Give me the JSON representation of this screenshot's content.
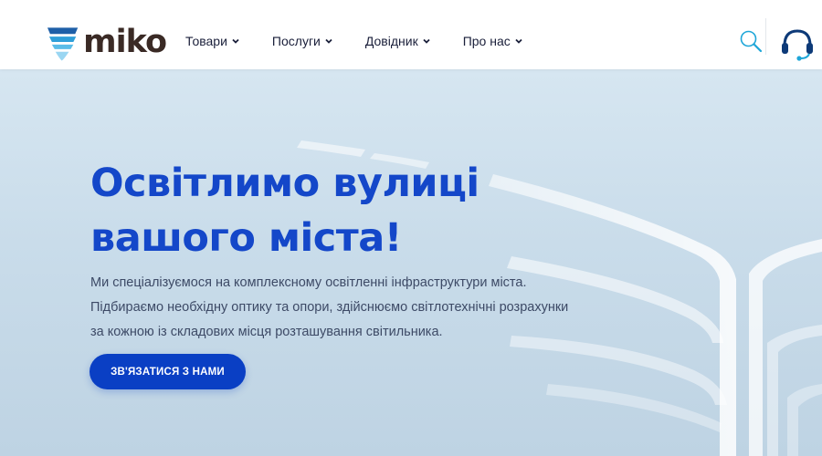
{
  "header": {
    "logo_text": "miko",
    "nav": [
      {
        "label": "Товари",
        "icon": "chevron-down-icon"
      },
      {
        "label": "Послуги",
        "icon": "chevron-down-icon"
      },
      {
        "label": "Довідник",
        "icon": "chevron-down-icon"
      },
      {
        "label": "Про нас",
        "icon": "chevron-down-icon"
      }
    ],
    "search_icon": "search-icon",
    "support_icon": "headset-icon"
  },
  "hero": {
    "title_line1": "Освітлимо вулиці",
    "title_line2": "вашого міста!",
    "text_line1": "Ми спеціалізуємося на комплексному освітленні інфраструктури міста.",
    "text_line2": "Підбираємо необхідну оптику та опори, здійснюємо світлотехнічні розрахунки",
    "text_line3": "за кожною із складових місця розташування світильника.",
    "cta_label": "ЗВ'ЯЗАТИСЯ З НАМИ"
  },
  "colors": {
    "brand_blue": "#1447c9",
    "button_blue": "#0a3fc4",
    "logo_dark": "#3a2a25",
    "accent_cyan": "#1ea6d8",
    "hero_bg": "#c9dcea"
  }
}
